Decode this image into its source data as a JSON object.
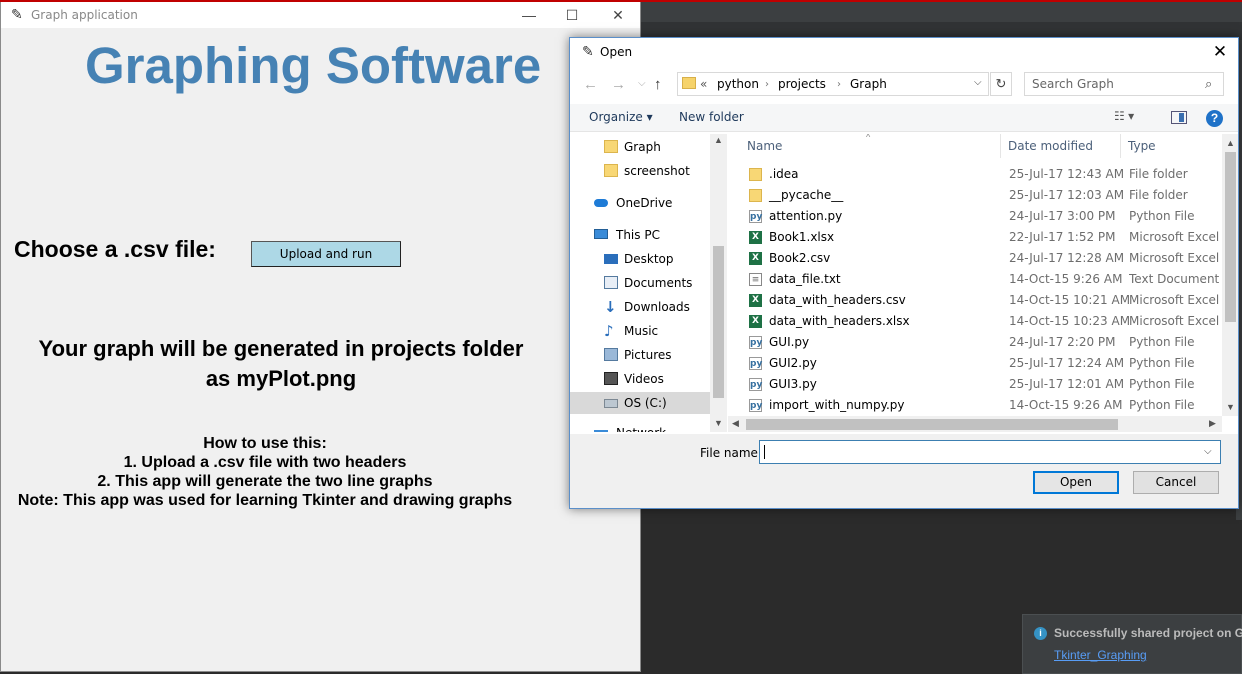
{
  "tk_window": {
    "title": "Graph application",
    "minimize_glyph": "—",
    "maximize_glyph": "☐",
    "close_glyph": "✕",
    "heading": "Graphing Software",
    "choose_label": "Choose a .csv file:",
    "upload_button": "Upload and run",
    "result_line1": "Your graph will be generated in projects folder",
    "result_line2": "as myPlot.png",
    "howto_title": "How to use this:",
    "howto_step1": "1. Upload a .csv file with two headers",
    "howto_step2": "2. This app will generate the two line graphs",
    "howto_note": "Note: This app was used for learning Tkinter and drawing graphs",
    "heading_color": "#4682b4",
    "button_color": "#add8e6"
  },
  "open_dialog": {
    "title": "Open",
    "close_glyph": "✕",
    "address": {
      "more": "«",
      "crumbs": [
        "python",
        "projects",
        "Graph"
      ],
      "separator": "›",
      "dropdown": "⌵",
      "refresh": "↻"
    },
    "search": {
      "placeholder": "Search Graph",
      "icon": "search-icon"
    },
    "toolbar": {
      "organize": "Organize ▾",
      "new_folder": "New folder",
      "view": "☷ ▾",
      "help": "?"
    },
    "nav_pane": {
      "items": [
        {
          "label": "Graph",
          "icon": "folder-icon"
        },
        {
          "label": "screenshot",
          "icon": "folder-icon"
        },
        {
          "label": "OneDrive",
          "icon": "onedrive-icon"
        },
        {
          "label": "This PC",
          "icon": "computer-icon"
        },
        {
          "label": "Desktop",
          "icon": "desktop-icon"
        },
        {
          "label": "Documents",
          "icon": "documents-icon"
        },
        {
          "label": "Downloads",
          "icon": "downloads-icon"
        },
        {
          "label": "Music",
          "icon": "music-icon"
        },
        {
          "label": "Pictures",
          "icon": "pictures-icon"
        },
        {
          "label": "Videos",
          "icon": "videos-icon"
        },
        {
          "label": "OS (C:)",
          "icon": "drive-icon",
          "selected": true
        },
        {
          "label": "Network",
          "icon": "network-icon"
        }
      ]
    },
    "columns": {
      "name": "Name",
      "date": "Date modified",
      "type": "Type"
    },
    "files": [
      {
        "name": ".idea",
        "date": "25-Jul-17 12:43 AM",
        "type": "File folder",
        "kind": "folder"
      },
      {
        "name": "__pycache__",
        "date": "25-Jul-17 12:03 AM",
        "type": "File folder",
        "kind": "folder"
      },
      {
        "name": "attention.py",
        "date": "24-Jul-17 3:00 PM",
        "type": "Python File",
        "kind": "py"
      },
      {
        "name": "Book1.xlsx",
        "date": "22-Jul-17 1:52 PM",
        "type": "Microsoft Excel W",
        "kind": "xlsx"
      },
      {
        "name": "Book2.csv",
        "date": "24-Jul-17 12:28 AM",
        "type": "Microsoft Excel C",
        "kind": "csv"
      },
      {
        "name": "data_file.txt",
        "date": "14-Oct-15 9:26 AM",
        "type": "Text Document",
        "kind": "txt"
      },
      {
        "name": "data_with_headers.csv",
        "date": "14-Oct-15 10:21 AM",
        "type": "Microsoft Excel C",
        "kind": "csv"
      },
      {
        "name": "data_with_headers.xlsx",
        "date": "14-Oct-15 10:23 AM",
        "type": "Microsoft Excel W",
        "kind": "xlsx"
      },
      {
        "name": "GUI.py",
        "date": "24-Jul-17 2:20 PM",
        "type": "Python File",
        "kind": "py"
      },
      {
        "name": "GUI2.py",
        "date": "25-Jul-17 12:24 AM",
        "type": "Python File",
        "kind": "py"
      },
      {
        "name": "GUI3.py",
        "date": "25-Jul-17 12:01 AM",
        "type": "Python File",
        "kind": "py"
      },
      {
        "name": "import_with_numpy.py",
        "date": "14-Oct-15 9:26 AM",
        "type": "Python File",
        "kind": "py"
      }
    ],
    "footer": {
      "filename_label": "File name:",
      "filename_value": "",
      "open_button": "Open",
      "cancel_button": "Cancel"
    }
  },
  "notification": {
    "icon": "i",
    "text": "Successfully shared project on Git",
    "link": "Tkinter_Graphing"
  }
}
